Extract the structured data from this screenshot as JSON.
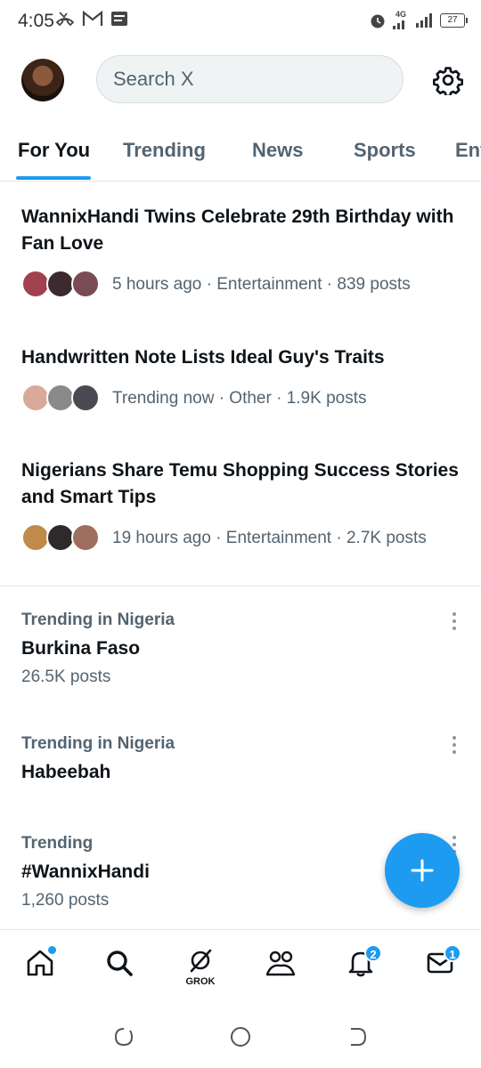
{
  "status_bar": {
    "time": "4:05",
    "network": "4G",
    "battery": "27"
  },
  "header": {
    "search_placeholder": "Search X"
  },
  "tabs": [
    {
      "label": "For You",
      "active": true
    },
    {
      "label": "Trending",
      "active": false
    },
    {
      "label": "News",
      "active": false
    },
    {
      "label": "Sports",
      "active": false
    },
    {
      "label": "Ent",
      "active": false
    }
  ],
  "stories": [
    {
      "title": "WannixHandi Twins Celebrate 29th Birthday with Fan Love",
      "meta": "5 hours ago · Entertainment · 839 posts"
    },
    {
      "title": "Handwritten Note Lists Ideal Guy's Traits",
      "meta": "Trending now · Other · 1.9K posts"
    },
    {
      "title": "Nigerians Share Temu Shopping Success Stories and Smart Tips",
      "meta": "19 hours ago · Entertainment · 2.7K posts"
    }
  ],
  "trends": [
    {
      "context": "Trending in Nigeria",
      "name": "Burkina Faso",
      "count": "26.5K posts"
    },
    {
      "context": "Trending in Nigeria",
      "name": "Habeebah",
      "count": ""
    },
    {
      "context": "Trending",
      "name": "#WannixHandi",
      "count": "1,260 posts"
    }
  ],
  "bottom_nav": {
    "grok_label": "GROK",
    "notifications_badge": "2",
    "messages_badge": "1"
  },
  "colors": {
    "accent": "#1d9bf0",
    "text_primary": "#0f1419",
    "text_secondary": "#536471"
  }
}
